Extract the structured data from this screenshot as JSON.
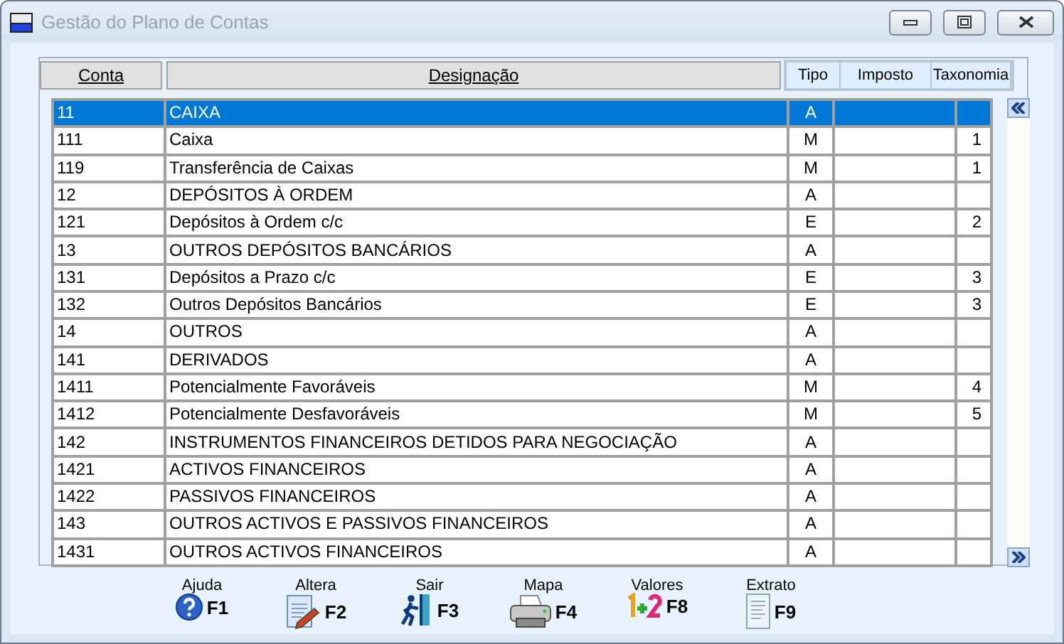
{
  "window": {
    "title": "Gestão do Plano de Contas"
  },
  "columns": {
    "conta": "Conta",
    "designacao": "Designação",
    "extra": [
      "Tipo",
      "Imposto",
      "Taxonomia"
    ]
  },
  "rows": [
    {
      "conta": "11",
      "designacao": "CAIXA",
      "tipo": "A",
      "taxonomia": "",
      "selected": true
    },
    {
      "conta": "111",
      "designacao": "Caixa",
      "tipo": "M",
      "taxonomia": "1",
      "selected": false
    },
    {
      "conta": "119",
      "designacao": "Transferência de Caixas",
      "tipo": "M",
      "taxonomia": "1",
      "selected": false
    },
    {
      "conta": "12",
      "designacao": "DEPÓSITOS À ORDEM",
      "tipo": "A",
      "taxonomia": "",
      "selected": false
    },
    {
      "conta": "121",
      "designacao": "Depósitos à Ordem c/c",
      "tipo": "E",
      "taxonomia": "2",
      "selected": false
    },
    {
      "conta": "13",
      "designacao": "OUTROS DEPÓSITOS BANCÁRIOS",
      "tipo": "A",
      "taxonomia": "",
      "selected": false
    },
    {
      "conta": "131",
      "designacao": "Depósitos a Prazo c/c",
      "tipo": "E",
      "taxonomia": "3",
      "selected": false
    },
    {
      "conta": "132",
      "designacao": "Outros Depósitos Bancários",
      "tipo": "E",
      "taxonomia": "3",
      "selected": false
    },
    {
      "conta": "14",
      "designacao": "OUTROS",
      "tipo": "A",
      "taxonomia": "",
      "selected": false
    },
    {
      "conta": "141",
      "designacao": "DERIVADOS",
      "tipo": "A",
      "taxonomia": "",
      "selected": false
    },
    {
      "conta": "1411",
      "designacao": "Potencialmente Favoráveis",
      "tipo": "M",
      "taxonomia": "4",
      "selected": false
    },
    {
      "conta": "1412",
      "designacao": "Potencialmente Desfavoráveis",
      "tipo": "M",
      "taxonomia": "5",
      "selected": false
    },
    {
      "conta": "142",
      "designacao": "INSTRUMENTOS FINANCEIROS DETIDOS PARA NEGOCIAÇÃO",
      "tipo": "A",
      "taxonomia": "",
      "selected": false
    },
    {
      "conta": "1421",
      "designacao": "ACTIVOS FINANCEIROS",
      "tipo": "A",
      "taxonomia": "",
      "selected": false
    },
    {
      "conta": "1422",
      "designacao": "PASSIVOS FINANCEIROS",
      "tipo": "A",
      "taxonomia": "",
      "selected": false
    },
    {
      "conta": "143",
      "designacao": "OUTROS ACTIVOS E PASSIVOS FINANCEIROS",
      "tipo": "A",
      "taxonomia": "",
      "selected": false
    },
    {
      "conta": "1431",
      "designacao": "OUTROS ACTIVOS FINANCEIROS",
      "tipo": "A",
      "taxonomia": "",
      "selected": false
    }
  ],
  "toolbar": [
    {
      "kind": "help",
      "label": "Ajuda",
      "key": "F1"
    },
    {
      "kind": "edit",
      "label": "Altera",
      "key": "F2"
    },
    {
      "kind": "exit",
      "label": "Sair",
      "key": "F3"
    },
    {
      "kind": "print",
      "label": "Mapa",
      "key": "F4"
    },
    {
      "kind": "values",
      "label": "Valores",
      "key": "F8"
    },
    {
      "kind": "statement",
      "label": "Extrato",
      "key": "F9"
    }
  ]
}
